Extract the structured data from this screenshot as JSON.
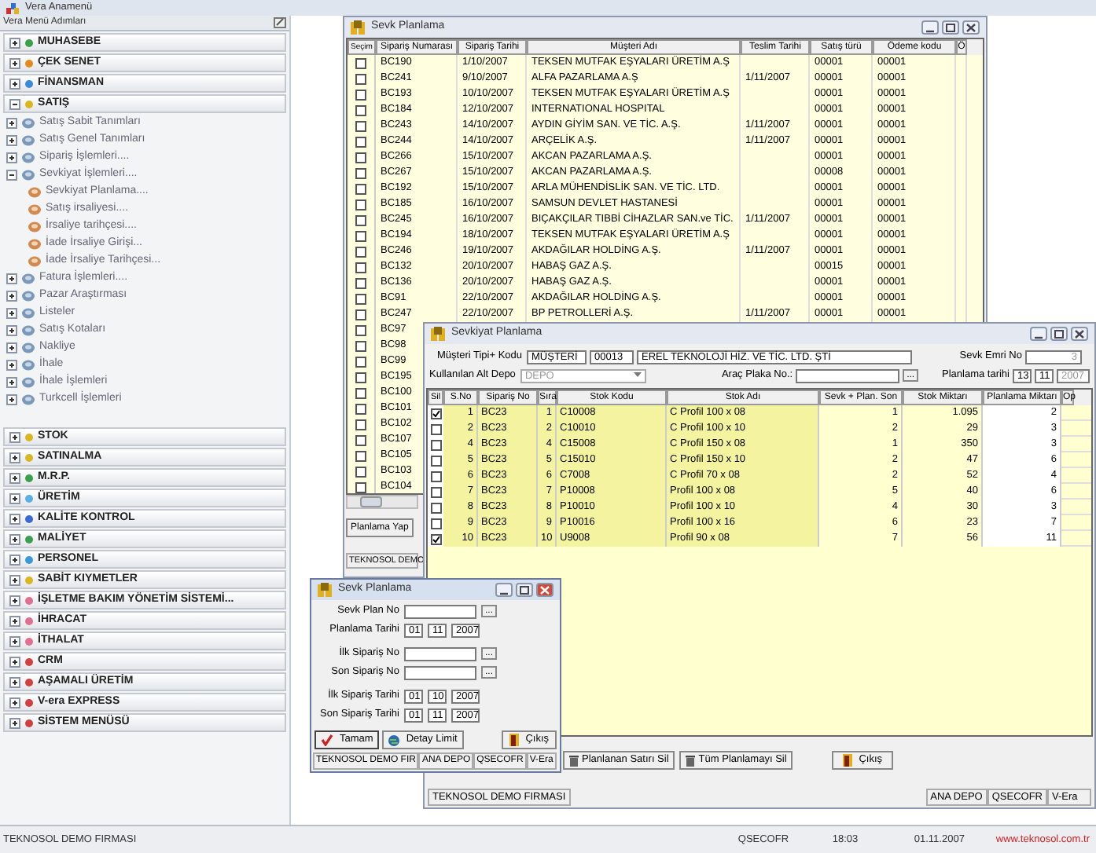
{
  "app_title": "Vera Anamenü",
  "menu": {
    "header": "Vera Menü Adımları",
    "sections_top": [
      {
        "label": "MUHASEBE",
        "color": "#3aa04a",
        "expanded": false
      },
      {
        "label": "ÇEK SENET",
        "color": "#e08a20",
        "expanded": false
      },
      {
        "label": "FİNANSMAN",
        "color": "#3a8ad8",
        "expanded": false
      },
      {
        "label": "SATIŞ",
        "color": "#d8b820",
        "expanded": true
      }
    ],
    "tree": [
      {
        "label": "Satış Sabit Tanımları",
        "expanded": false
      },
      {
        "label": "Satış Genel Tanımları",
        "expanded": false
      },
      {
        "label": "Sipariş İşlemleri....",
        "expanded": false
      },
      {
        "label": "Sevkiyat İşlemleri....",
        "expanded": true,
        "children": [
          {
            "label": "Sevkiyat Planlama...."
          },
          {
            "label": "Satış irsaliyesi...."
          },
          {
            "label": "İrsaliye tarihçesi...."
          },
          {
            "label": "İade İrsaliye Girişi..."
          },
          {
            "label": "İade İrsaliye Tarihçesi..."
          }
        ]
      },
      {
        "label": "Fatura İşlemleri....",
        "expanded": false
      },
      {
        "label": "Pazar Araştırması",
        "expanded": false
      },
      {
        "label": "Listeler",
        "expanded": false
      },
      {
        "label": "Satış Kotaları",
        "expanded": false
      },
      {
        "label": "Nakliye",
        "expanded": false
      },
      {
        "label": "İhale",
        "expanded": false
      },
      {
        "label": "İhale İşlemleri",
        "expanded": false
      },
      {
        "label": "Turkcell İşlemleri",
        "expanded": false
      }
    ],
    "sections_bottom": [
      {
        "label": "STOK",
        "color": "#d8b820",
        "expanded": false
      },
      {
        "label": "SATINALMA",
        "color": "#d8b820",
        "expanded": false
      },
      {
        "label": "M.R.P.",
        "color": "#3aa04a",
        "expanded": false
      },
      {
        "label": "ÜRETİM",
        "color": "#5ab0e0",
        "expanded": false
      },
      {
        "label": "KALİTE KONTROL",
        "color": "#3a6ad0",
        "expanded": false
      },
      {
        "label": "MALİYET",
        "color": "#3aa050",
        "expanded": false
      },
      {
        "label": "PERSONEL",
        "color": "#3a9ad8",
        "expanded": false
      },
      {
        "label": "SABİT KIYMETLER",
        "color": "#d8b821",
        "expanded": false
      },
      {
        "label": "İŞLETME BAKIM YÖNETİM SİSTEMİ...",
        "color": "#e07090",
        "expanded": false
      },
      {
        "label": "İHRACAT",
        "color": "#e07091",
        "expanded": false
      },
      {
        "label": "İTHALAT",
        "color": "#e07092",
        "expanded": false
      },
      {
        "label": "CRM",
        "color": "#d04040",
        "expanded": false
      },
      {
        "label": "AŞAMALI ÜRETİM",
        "color": "#d04041",
        "expanded": false
      },
      {
        "label": "V-era EXPRESS",
        "color": "#d04042",
        "expanded": false
      },
      {
        "label": "SİSTEM MENÜSÜ",
        "color": "#d04043",
        "expanded": false
      }
    ]
  },
  "order_window": {
    "title": "Sevk Planlama",
    "check_column": "Seçim",
    "columns": [
      "Sipariş Numarası",
      "Sipariş Tarihi",
      "Müşteri Adı",
      "Teslim Tarihi",
      "Satış türü",
      "Ödeme kodu",
      "Ö"
    ],
    "rows": [
      {
        "checked": false,
        "cells": [
          "BC190",
          "1/10/2007",
          "TEKSEN MUTFAK EŞYALARI ÜRETİM A.Ş",
          "",
          "00001",
          "00001"
        ]
      },
      {
        "checked": false,
        "cells": [
          "BC241",
          "9/10/2007",
          "ALFA PAZARLAMA A.Ş",
          "1/11/2007",
          "00001",
          "00001"
        ]
      },
      {
        "checked": false,
        "cells": [
          "BC193",
          "10/10/2007",
          "TEKSEN MUTFAK EŞYALARI ÜRETİM A.Ş",
          "",
          "00001",
          "00001"
        ]
      },
      {
        "checked": false,
        "cells": [
          "BC184",
          "12/10/2007",
          "INTERNATIONAL HOSPITAL",
          "",
          "00001",
          "00001"
        ]
      },
      {
        "checked": false,
        "cells": [
          "BC243",
          "14/10/2007",
          "AYDIN GİYİM SAN. VE TİC. A.Ş.",
          "1/11/2007",
          "00001",
          "00001"
        ]
      },
      {
        "checked": false,
        "cells": [
          "BC244",
          "14/10/2007",
          "ARÇELİK A.Ş.",
          "1/11/2007",
          "00001",
          "00001"
        ]
      },
      {
        "checked": false,
        "cells": [
          "BC266",
          "15/10/2007",
          "AKCAN PAZARLAMA A.Ş.",
          "",
          "00001",
          "00001"
        ]
      },
      {
        "checked": false,
        "cells": [
          "BC267",
          "15/10/2007",
          "AKCAN PAZARLAMA A.Ş.",
          "",
          "00008",
          "00001"
        ]
      },
      {
        "checked": false,
        "cells": [
          "BC192",
          "15/10/2007",
          "ARLA  MÜHENDİSLİK SAN. VE TİC. LTD.",
          "",
          "00001",
          "00001"
        ]
      },
      {
        "checked": false,
        "cells": [
          "BC185",
          "16/10/2007",
          "SAMSUN DEVLET HASTANESİ",
          "",
          "00001",
          "00001"
        ]
      },
      {
        "checked": false,
        "cells": [
          "BC245",
          "16/10/2007",
          "BIÇAKÇILAR TIBBİ CİHAZLAR SAN.ve TİC.",
          "1/11/2007",
          "00001",
          "00001"
        ]
      },
      {
        "checked": false,
        "cells": [
          "BC194",
          "18/10/2007",
          "TEKSEN MUTFAK EŞYALARI ÜRETİM A.Ş",
          "",
          "00001",
          "00001"
        ]
      },
      {
        "checked": false,
        "cells": [
          "BC246",
          "19/10/2007",
          "AKDAĞILAR  HOLDİNG A.Ş.",
          "1/11/2007",
          "00001",
          "00001"
        ]
      },
      {
        "checked": false,
        "cells": [
          "BC132",
          "20/10/2007",
          "HABAŞ GAZ A.Ş.",
          "",
          "00015",
          "00001"
        ]
      },
      {
        "checked": false,
        "cells": [
          "BC136",
          "20/10/2007",
          "HABAŞ GAZ A.Ş.",
          "",
          "00001",
          "00001"
        ]
      },
      {
        "checked": false,
        "cells": [
          "BC91",
          "22/10/2007",
          "AKDAĞILAR  HOLDİNG A.Ş.",
          "",
          "00001",
          "00001"
        ]
      },
      {
        "checked": false,
        "cells": [
          "BC247",
          "22/10/2007",
          "BP PETROLLERİ A.Ş.",
          "1/11/2007",
          "00001",
          "00001"
        ]
      },
      {
        "checked": false,
        "cells": [
          "BC97"
        ]
      },
      {
        "checked": false,
        "cells": [
          "BC98"
        ]
      },
      {
        "checked": false,
        "cells": [
          "BC99"
        ]
      },
      {
        "checked": false,
        "cells": [
          "BC195"
        ]
      },
      {
        "checked": false,
        "cells": [
          "BC100"
        ]
      },
      {
        "checked": false,
        "cells": [
          "BC101"
        ]
      },
      {
        "checked": false,
        "cells": [
          "BC102"
        ]
      },
      {
        "checked": false,
        "cells": [
          "BC107"
        ]
      },
      {
        "checked": false,
        "cells": [
          "BC105"
        ]
      },
      {
        "checked": false,
        "cells": [
          "BC103"
        ]
      },
      {
        "checked": false,
        "cells": [
          "BC104"
        ]
      }
    ],
    "button": "Planlama Yap",
    "status": "TEKNOSOL DEMO"
  },
  "shipment_window": {
    "title": "Sevkiyat Planlama",
    "customer_label": "Müşteri Tipi+ Kodu",
    "customer_type": "MÜŞTERİ",
    "customer_code": "00013",
    "customer_name": "EREL TEKNOLOJİ HİZ. VE TİC. LTD. ŞTİ",
    "order_no_label": "Sevk Emri No",
    "order_no": "3",
    "depot_label": "Kullanılan Alt Depo",
    "depot": "DEPO",
    "plate_label": "Araç Plaka No.:",
    "browse": "...",
    "date_label": "Planlama tarihi",
    "date": [
      "13",
      "11",
      "2007"
    ],
    "check_column": "Sil",
    "columns": [
      "S.No",
      "Sipariş No",
      "Sıra",
      "Stok Kodu",
      "Stok Adı",
      "Sevk + Plan. Son",
      "Stok Miktarı",
      "Planlama Miktarı",
      "Op"
    ],
    "rows": [
      {
        "checked": true,
        "cells": [
          "1",
          "BC23",
          "1",
          "C10008",
          "C Profil 100 x 08",
          "1",
          "1.095",
          "2"
        ]
      },
      {
        "checked": false,
        "cells": [
          "2",
          "BC23",
          "2",
          "C10010",
          "C Profil 100 x 10",
          "2",
          "29",
          "3"
        ]
      },
      {
        "checked": false,
        "cells": [
          "4",
          "BC23",
          "4",
          "C15008",
          "C Profil 150 x 08",
          "1",
          "350",
          "3"
        ]
      },
      {
        "checked": false,
        "cells": [
          "5",
          "BC23",
          "5",
          "C15010",
          "C Profil 150 x 10",
          "2",
          "47",
          "6"
        ]
      },
      {
        "checked": false,
        "cells": [
          "6",
          "BC23",
          "6",
          "C7008",
          "C Profil 70 x 08",
          "2",
          "52",
          "4"
        ]
      },
      {
        "checked": false,
        "cells": [
          "7",
          "BC23",
          "7",
          "P10008",
          "Profil 100 x 08",
          "5",
          "40",
          "6"
        ]
      },
      {
        "checked": false,
        "cells": [
          "8",
          "BC23",
          "8",
          "P10010",
          "Profil 100 x 10",
          "4",
          "30",
          "3"
        ]
      },
      {
        "checked": false,
        "cells": [
          "9",
          "BC23",
          "9",
          "P10016",
          "Profil 100 x 16",
          "6",
          "23",
          "7"
        ]
      },
      {
        "checked": true,
        "cells": [
          "10",
          "BC23",
          "10",
          "U9008",
          "Profil 90 x 08",
          "7",
          "56",
          "11"
        ]
      }
    ],
    "buttons": [
      "Planlanan Satırı Sil",
      "Tüm Planlamayı Sil"
    ],
    "exit": "Çıkış",
    "status_left": "TEKNOSOL DEMO FIRMASI",
    "status_right": [
      "ANA DEPO",
      "QSECOFR",
      "V-Era"
    ]
  },
  "plan_dialog": {
    "title": "Sevk Planlama",
    "fields": [
      {
        "kind": "lookup",
        "label": "Sevk Plan No",
        "browse": "..."
      },
      {
        "kind": "date",
        "label": "Planlama Tarihi",
        "date": [
          "01",
          "11",
          "2007"
        ]
      },
      {
        "kind": "lookup",
        "label": "İlk Sipariş No",
        "browse": "..."
      },
      {
        "kind": "lookup",
        "label": "Son Sipariş No",
        "browse": "..."
      },
      {
        "kind": "date",
        "label": "İlk Sipariş Tarihi",
        "date": [
          "01",
          "10",
          "2007"
        ]
      },
      {
        "kind": "date",
        "label": "Son Sipariş Tarihi",
        "date": [
          "01",
          "11",
          "2007"
        ]
      }
    ],
    "ok": "Tamam",
    "detail": "Detay Limit",
    "exit": "Çıkış",
    "status": [
      "TEKNOSOL DEMO FIR",
      "ANA DEPO",
      "QSECOFR",
      "V-Era"
    ]
  },
  "status_bar": {
    "company": "TEKNOSOL DEMO FIRMASI",
    "user": "QSECOFR",
    "time": "18:03",
    "date": "01.11.2007",
    "website": "www.teknosol.com.tr"
  }
}
